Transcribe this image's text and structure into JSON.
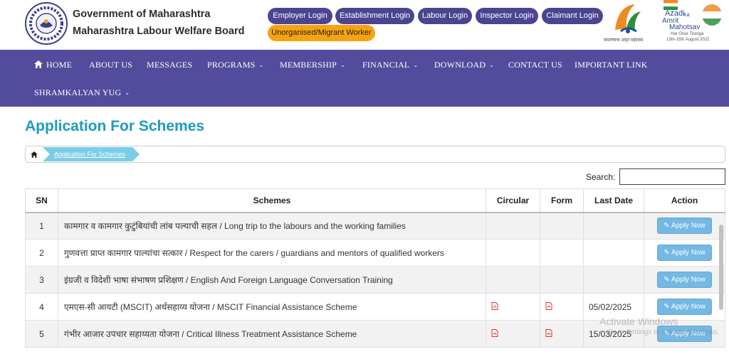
{
  "header": {
    "org_title": "Government of Maharashtra",
    "org_subtitle": "Maharashtra Labour Welfare Board",
    "logins": [
      {
        "label": "Employer Login"
      },
      {
        "label": "Establishment Login"
      },
      {
        "label": "Labour Login"
      },
      {
        "label": "Inspector Login"
      },
      {
        "label": "Claimant Login"
      },
      {
        "label": "Unorganised/Migrant Worker"
      }
    ],
    "badge": {
      "g20_caption": "स्वातंत्र्याचा अमृत महोत्सव",
      "azadi_line1": "Azadi",
      "azadi_ka": "Ka",
      "azadi_line2": "Amrit",
      "azadi_line3": "Mahotsav",
      "har_ghar": "Har Ghar Tiranga",
      "dates": "13th-15th August 2022"
    }
  },
  "nav": {
    "items": [
      {
        "label": "HOME"
      },
      {
        "label": "ABOUT US"
      },
      {
        "label": "MESSAGES"
      },
      {
        "label": "PROGRAMS"
      },
      {
        "label": "MEMBERSHIP"
      },
      {
        "label": "FINANCIAL"
      },
      {
        "label": "DOWNLOAD"
      },
      {
        "label": "CONTACT US"
      },
      {
        "label": "IMPORTANT LINK"
      },
      {
        "label": "SHRAMKALYAN YUG"
      }
    ]
  },
  "page": {
    "title": "Application For Schemes",
    "breadcrumb": "Application For Schemes",
    "search_label": "Search:",
    "search_value": ""
  },
  "table": {
    "headers": {
      "sn": "SN",
      "schemes": "Schemes",
      "circular": "Circular",
      "form": "Form",
      "last_date": "Last Date",
      "action": "Action"
    },
    "rows": [
      {
        "sn": "1",
        "scheme": "कामगार व कामगार कुटुंबियांची लांब पल्याची सहल / Long trip to the labours and the working families",
        "last_date": "",
        "action": "Apply Now"
      },
      {
        "sn": "2",
        "scheme": "गुणवत्ता प्राप्त कामगार पाल्यांचा सत्कार / Respect for the carers / guardians and mentors of qualified workers",
        "last_date": "",
        "action": "Apply Now"
      },
      {
        "sn": "3",
        "scheme": "इंग्रजी व विदेशी भाषा संभाषण प्रशिक्षण / English And Foreign Language Conversation Training",
        "last_date": "",
        "action": "Apply Now"
      },
      {
        "sn": "4",
        "scheme": "एमएस-सी आयटी (MSCIT) अर्थसहाय्य योजना / MSCIT Financial Assistance Scheme",
        "last_date": "05/02/2025",
        "action": "Apply Now"
      },
      {
        "sn": "5",
        "scheme": "गंभीर आजार उपचार सहाय्यता योजना / Critical Illness Treatment Assistance Scheme",
        "last_date": "15/03/2025",
        "action": "Apply Now"
      }
    ]
  },
  "watermark": {
    "line1": "Activate Windows",
    "line2": "Go to Settings to activate Windows."
  },
  "colors": {
    "nav_bg": "#534c9d",
    "login_btn": "#4b4490",
    "unorganised_btn": "#f6a313",
    "title": "#1e9bc0",
    "apply_btn": "#74b8e3",
    "pdf": "#d9382c"
  }
}
